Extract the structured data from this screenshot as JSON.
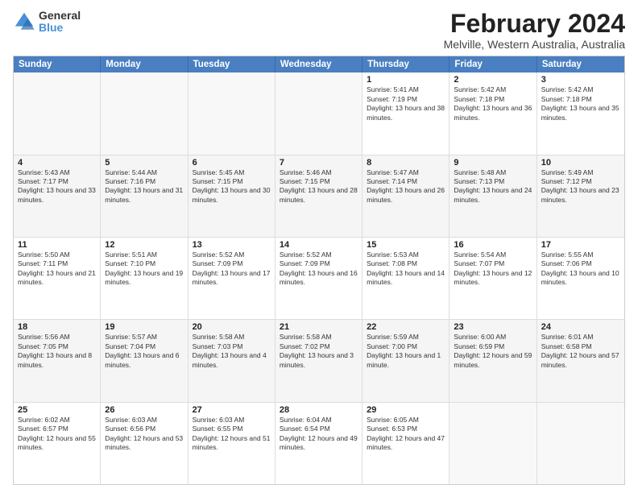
{
  "logo": {
    "general": "General",
    "blue": "Blue"
  },
  "title": "February 2024",
  "subtitle": "Melville, Western Australia, Australia",
  "days_of_week": [
    "Sunday",
    "Monday",
    "Tuesday",
    "Wednesday",
    "Thursday",
    "Friday",
    "Saturday"
  ],
  "weeks": [
    [
      {
        "day": "",
        "empty": true
      },
      {
        "day": "",
        "empty": true
      },
      {
        "day": "",
        "empty": true
      },
      {
        "day": "",
        "empty": true
      },
      {
        "day": "1",
        "sunrise": "Sunrise: 5:41 AM",
        "sunset": "Sunset: 7:19 PM",
        "daylight": "Daylight: 13 hours and 38 minutes."
      },
      {
        "day": "2",
        "sunrise": "Sunrise: 5:42 AM",
        "sunset": "Sunset: 7:18 PM",
        "daylight": "Daylight: 13 hours and 36 minutes."
      },
      {
        "day": "3",
        "sunrise": "Sunrise: 5:42 AM",
        "sunset": "Sunset: 7:18 PM",
        "daylight": "Daylight: 13 hours and 35 minutes."
      }
    ],
    [
      {
        "day": "4",
        "sunrise": "Sunrise: 5:43 AM",
        "sunset": "Sunset: 7:17 PM",
        "daylight": "Daylight: 13 hours and 33 minutes."
      },
      {
        "day": "5",
        "sunrise": "Sunrise: 5:44 AM",
        "sunset": "Sunset: 7:16 PM",
        "daylight": "Daylight: 13 hours and 31 minutes."
      },
      {
        "day": "6",
        "sunrise": "Sunrise: 5:45 AM",
        "sunset": "Sunset: 7:15 PM",
        "daylight": "Daylight: 13 hours and 30 minutes."
      },
      {
        "day": "7",
        "sunrise": "Sunrise: 5:46 AM",
        "sunset": "Sunset: 7:15 PM",
        "daylight": "Daylight: 13 hours and 28 minutes."
      },
      {
        "day": "8",
        "sunrise": "Sunrise: 5:47 AM",
        "sunset": "Sunset: 7:14 PM",
        "daylight": "Daylight: 13 hours and 26 minutes."
      },
      {
        "day": "9",
        "sunrise": "Sunrise: 5:48 AM",
        "sunset": "Sunset: 7:13 PM",
        "daylight": "Daylight: 13 hours and 24 minutes."
      },
      {
        "day": "10",
        "sunrise": "Sunrise: 5:49 AM",
        "sunset": "Sunset: 7:12 PM",
        "daylight": "Daylight: 13 hours and 23 minutes."
      }
    ],
    [
      {
        "day": "11",
        "sunrise": "Sunrise: 5:50 AM",
        "sunset": "Sunset: 7:11 PM",
        "daylight": "Daylight: 13 hours and 21 minutes."
      },
      {
        "day": "12",
        "sunrise": "Sunrise: 5:51 AM",
        "sunset": "Sunset: 7:10 PM",
        "daylight": "Daylight: 13 hours and 19 minutes."
      },
      {
        "day": "13",
        "sunrise": "Sunrise: 5:52 AM",
        "sunset": "Sunset: 7:09 PM",
        "daylight": "Daylight: 13 hours and 17 minutes."
      },
      {
        "day": "14",
        "sunrise": "Sunrise: 5:52 AM",
        "sunset": "Sunset: 7:09 PM",
        "daylight": "Daylight: 13 hours and 16 minutes."
      },
      {
        "day": "15",
        "sunrise": "Sunrise: 5:53 AM",
        "sunset": "Sunset: 7:08 PM",
        "daylight": "Daylight: 13 hours and 14 minutes."
      },
      {
        "day": "16",
        "sunrise": "Sunrise: 5:54 AM",
        "sunset": "Sunset: 7:07 PM",
        "daylight": "Daylight: 13 hours and 12 minutes."
      },
      {
        "day": "17",
        "sunrise": "Sunrise: 5:55 AM",
        "sunset": "Sunset: 7:06 PM",
        "daylight": "Daylight: 13 hours and 10 minutes."
      }
    ],
    [
      {
        "day": "18",
        "sunrise": "Sunrise: 5:56 AM",
        "sunset": "Sunset: 7:05 PM",
        "daylight": "Daylight: 13 hours and 8 minutes."
      },
      {
        "day": "19",
        "sunrise": "Sunrise: 5:57 AM",
        "sunset": "Sunset: 7:04 PM",
        "daylight": "Daylight: 13 hours and 6 minutes."
      },
      {
        "day": "20",
        "sunrise": "Sunrise: 5:58 AM",
        "sunset": "Sunset: 7:03 PM",
        "daylight": "Daylight: 13 hours and 4 minutes."
      },
      {
        "day": "21",
        "sunrise": "Sunrise: 5:58 AM",
        "sunset": "Sunset: 7:02 PM",
        "daylight": "Daylight: 13 hours and 3 minutes."
      },
      {
        "day": "22",
        "sunrise": "Sunrise: 5:59 AM",
        "sunset": "Sunset: 7:00 PM",
        "daylight": "Daylight: 13 hours and 1 minute."
      },
      {
        "day": "23",
        "sunrise": "Sunrise: 6:00 AM",
        "sunset": "Sunset: 6:59 PM",
        "daylight": "Daylight: 12 hours and 59 minutes."
      },
      {
        "day": "24",
        "sunrise": "Sunrise: 6:01 AM",
        "sunset": "Sunset: 6:58 PM",
        "daylight": "Daylight: 12 hours and 57 minutes."
      }
    ],
    [
      {
        "day": "25",
        "sunrise": "Sunrise: 6:02 AM",
        "sunset": "Sunset: 6:57 PM",
        "daylight": "Daylight: 12 hours and 55 minutes."
      },
      {
        "day": "26",
        "sunrise": "Sunrise: 6:03 AM",
        "sunset": "Sunset: 6:56 PM",
        "daylight": "Daylight: 12 hours and 53 minutes."
      },
      {
        "day": "27",
        "sunrise": "Sunrise: 6:03 AM",
        "sunset": "Sunset: 6:55 PM",
        "daylight": "Daylight: 12 hours and 51 minutes."
      },
      {
        "day": "28",
        "sunrise": "Sunrise: 6:04 AM",
        "sunset": "Sunset: 6:54 PM",
        "daylight": "Daylight: 12 hours and 49 minutes."
      },
      {
        "day": "29",
        "sunrise": "Sunrise: 6:05 AM",
        "sunset": "Sunset: 6:53 PM",
        "daylight": "Daylight: 12 hours and 47 minutes."
      },
      {
        "day": "",
        "empty": true
      },
      {
        "day": "",
        "empty": true
      }
    ]
  ]
}
